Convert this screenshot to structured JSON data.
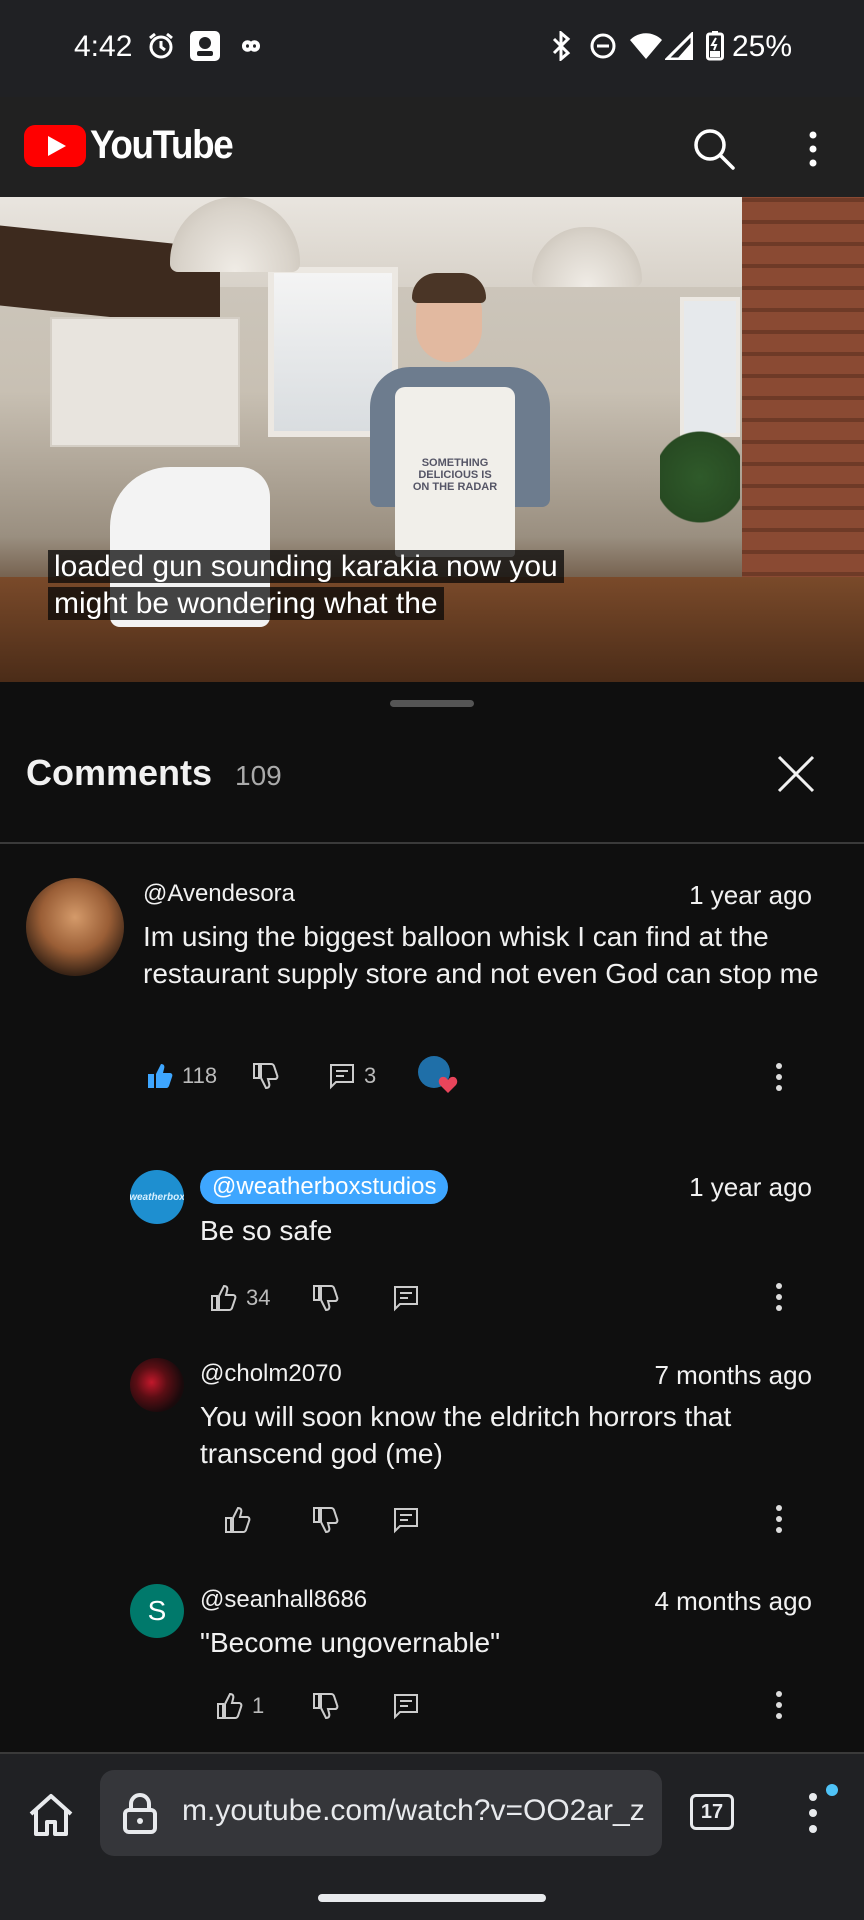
{
  "status_bar": {
    "time": "4:42",
    "battery": "25%",
    "left_icons": [
      "alarm-icon",
      "app-notification-icon",
      "infinity-icon"
    ],
    "right_icons": [
      "bluetooth-icon",
      "do-not-disturb-icon",
      "wifi-icon",
      "cell-signal-icon",
      "battery-icon"
    ]
  },
  "header": {
    "logo_text": "YouTube",
    "brand_color": "#ff0000"
  },
  "video": {
    "caption_line1": "loaded gun sounding karakia now you",
    "caption_line2": "might be wondering what the",
    "apron_text": "SOMETHING DELICIOUS IS ON THE RADAR"
  },
  "comments": {
    "title": "Comments",
    "count": "109",
    "items": [
      {
        "handle": "@Avendesora",
        "time": "1 year ago",
        "text": "Im using the biggest balloon whisk I can find at the restaurant supply store and not even God can stop me",
        "likes": "118",
        "replies": "3",
        "liked": true,
        "creator_hearted": true
      }
    ],
    "replies": [
      {
        "handle": "@weatherboxstudios",
        "is_creator": true,
        "avatar_text": "weatherbox",
        "time": "1 year ago",
        "text": "Be so safe",
        "likes": "34"
      },
      {
        "handle": "@cholm2070",
        "time": "7 months ago",
        "text": "You will soon know the eldritch horrors that transcend god (me)",
        "likes": ""
      },
      {
        "handle": "@seanhall8686",
        "avatar_text": "S",
        "avatar_color": "#00796b",
        "time": "4 months ago",
        "text": "\"Become ungovernable\"",
        "likes": "1"
      }
    ]
  },
  "browser": {
    "url": "m.youtube.com/watch?v=OO2ar_z",
    "tab_count": "17",
    "accent_dot": "#4fc3f7"
  }
}
